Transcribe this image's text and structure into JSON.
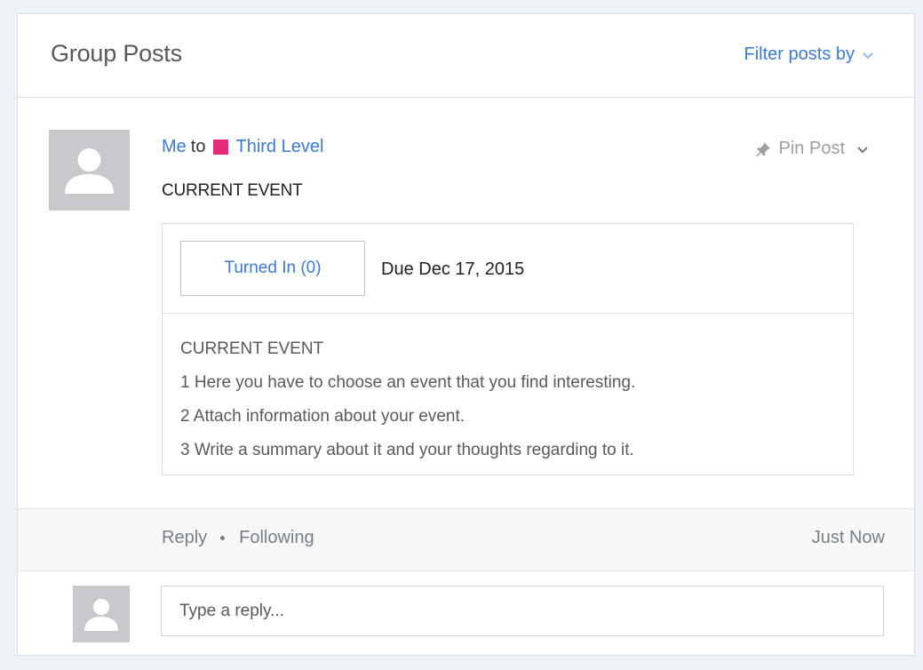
{
  "header": {
    "title": "Group Posts",
    "filter_label": "Filter posts by",
    "filter_icon": "chevron-down-icon"
  },
  "post": {
    "author": "Me",
    "to_word": "to",
    "group_name": "Third Level",
    "group_color": "#e6287a",
    "title": "CURRENT EVENT",
    "pin_label": "Pin Post",
    "pin_icon": "pin-icon",
    "assignment": {
      "turned_in_label": "Turned In (0)",
      "due_label": "Due Dec 17, 2015",
      "body_lines": [
        "CURRENT EVENT",
        "1 Here you have to choose an event that you find interesting.",
        "2 Attach information about your event.",
        "3 Write a summary about it and your thoughts regarding to it."
      ]
    }
  },
  "footer": {
    "reply_label": "Reply",
    "following_label": "Following",
    "timestamp": "Just Now"
  },
  "reply_box": {
    "placeholder": "Type a reply...",
    "value": ""
  },
  "colors": {
    "link": "#3a7bd5",
    "muted": "#7a7f85",
    "avatar_bg": "#c7c9cd"
  }
}
